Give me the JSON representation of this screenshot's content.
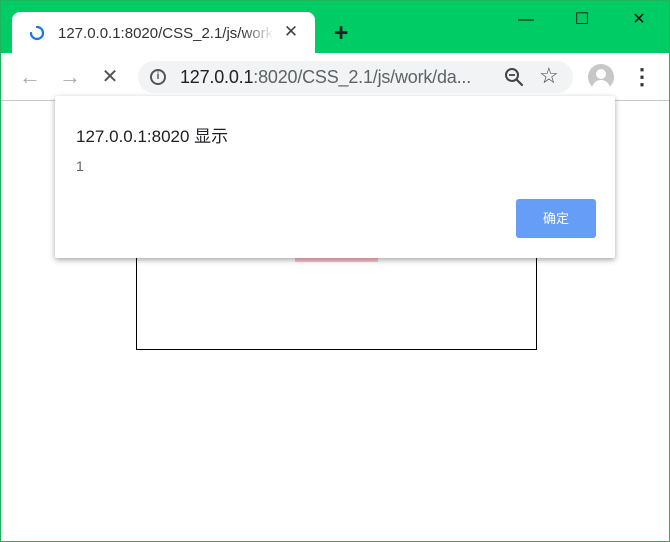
{
  "browser": {
    "tab": {
      "title": "127.0.0.1:8020/CSS_2.1/js/work/da",
      "close_glyph": "✕"
    },
    "new_tab_glyph": "+",
    "window_controls": {
      "minimize": "—",
      "maximize": "☐",
      "close": "✕"
    },
    "nav": {
      "back": "←",
      "forward": "→",
      "stop": "✕"
    },
    "address": {
      "host": "127.0.0.1",
      "path": ":8020/CSS_2.1/js/work/da..."
    },
    "menu_glyph": "⋮",
    "star_glyph": "☆"
  },
  "dialog": {
    "title": "127.0.0.1:8020 显示",
    "message": "1",
    "ok_label": "确定"
  },
  "colors": {
    "titlebar": "#00cc66",
    "pink_box": "#ffc0cb",
    "ok_button": "#669df6"
  }
}
